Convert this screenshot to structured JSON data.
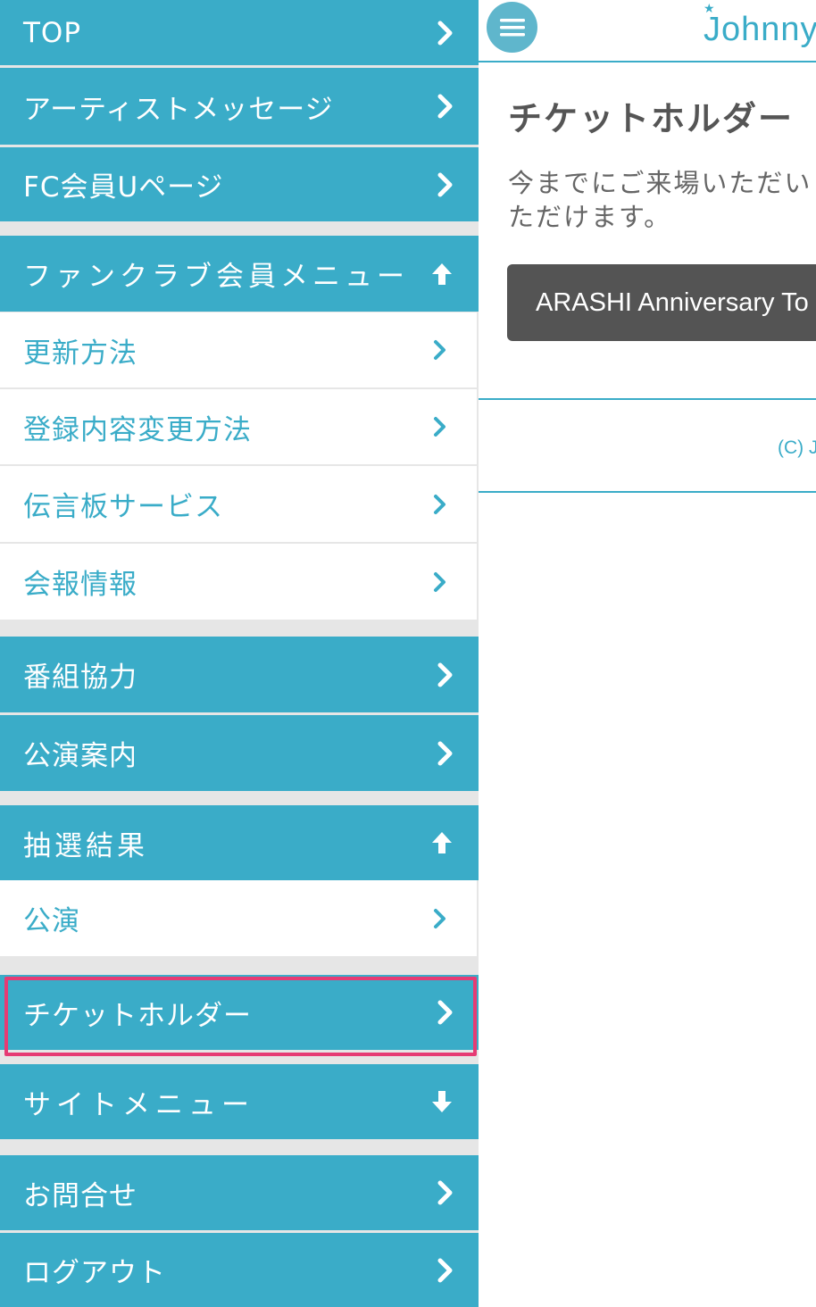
{
  "menu": {
    "top": "TOP",
    "artist_message": "アーティストメッセージ",
    "fc_member_page": "FC会員Uページ",
    "fanclub_menu": {
      "label": "ファンクラブ会員メニュー",
      "state": "expanded",
      "items": [
        "更新方法",
        "登録内容変更方法",
        "伝言板サービス",
        "会報情報"
      ]
    },
    "program_cooperation": "番組協力",
    "performance_info": "公演案内",
    "lottery_results": {
      "label": "抽選結果",
      "state": "expanded",
      "items": [
        "公演"
      ]
    },
    "ticket_holder": "チケットホルダー",
    "site_menu": {
      "label": "サイトメニュー",
      "state": "collapsed"
    },
    "contact": "お問合せ",
    "logout": "ログアウト"
  },
  "header": {
    "logo": "Johnnys",
    "menu_icon": "hamburger-icon"
  },
  "main": {
    "title": "チケットホルダー",
    "description_lines": [
      "今までにご来場いただい",
      "ただけます。"
    ],
    "tour_button": "ARASHI Anniversary To",
    "copyright": "(C) J"
  },
  "colors": {
    "menu_blue": "#3aacc8",
    "highlight_border": "#e63b74",
    "dark_button": "#545454"
  }
}
